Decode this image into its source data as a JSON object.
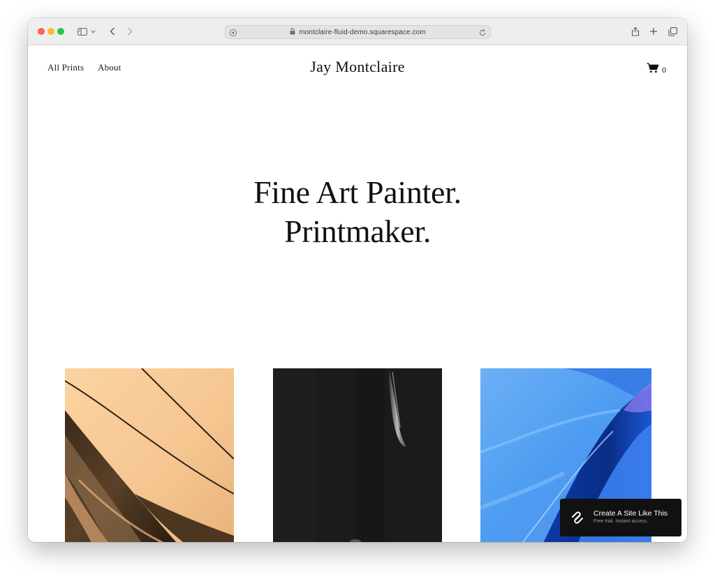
{
  "browser": {
    "url": "montclaire-fluid-demo.squarespace.com",
    "icons": {
      "sidebar": "sidebar-icon",
      "chevron": "chevron-down-icon",
      "back": "back-arrow-icon",
      "forward": "forward-arrow-icon",
      "privacy": "privacy-report-icon",
      "lock": "lock-icon",
      "reload": "reload-icon",
      "share": "share-icon",
      "new_tab": "plus-icon",
      "tabs": "tab-overview-icon"
    }
  },
  "site": {
    "nav": [
      {
        "label": "All Prints"
      },
      {
        "label": "About"
      }
    ],
    "title": "Jay Montclaire",
    "cart": {
      "icon": "cart-icon",
      "count": "0"
    }
  },
  "hero": {
    "line1": "Fine Art Painter.",
    "line2": "Printmaker."
  },
  "gallery": [
    {
      "name": "peach-abstract-print",
      "accent": "#f6c896"
    },
    {
      "name": "black-abstract-print",
      "accent": "#1b1b1b"
    },
    {
      "name": "blue-abstract-print",
      "accent": "#3e8ef0"
    }
  ],
  "promo": {
    "title": "Create A Site Like This",
    "subtitle": "Free trial. Instant access.",
    "icon": "squarespace-logo-icon"
  },
  "colors": {
    "text": "#111111",
    "chrome": "#eeeeee",
    "promo_bg": "#111111"
  }
}
